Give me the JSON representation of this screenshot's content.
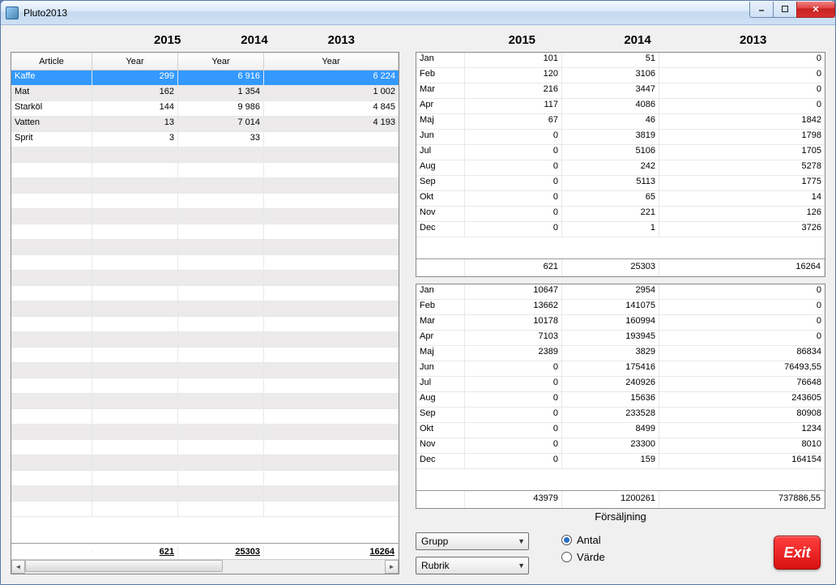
{
  "window": {
    "title": "Pluto2013"
  },
  "years": [
    "2015",
    "2014",
    "2013"
  ],
  "left": {
    "headers": [
      "Article",
      "Year",
      "Year",
      "Year"
    ],
    "rows": [
      {
        "article": "Kaffe",
        "y2015": "299",
        "y2014": "6 916",
        "y2013": "6 224",
        "selected": true
      },
      {
        "article": "Mat",
        "y2015": "162",
        "y2014": "1 354",
        "y2013": "1 002"
      },
      {
        "article": "Starköl",
        "y2015": "144",
        "y2014": "9 986",
        "y2013": "4 845"
      },
      {
        "article": "Vatten",
        "y2015": "13",
        "y2014": "7 014",
        "y2013": "4 193"
      },
      {
        "article": "Sprit",
        "y2015": "3",
        "y2014": "33",
        "y2013": ""
      }
    ],
    "empty_rows": 24,
    "footer": {
      "y2015": "621",
      "y2014": "25303",
      "y2013": "16264"
    }
  },
  "top_right": {
    "rows": [
      {
        "m": "Jan",
        "y2015": "101",
        "y2014": "51",
        "y2013": "0"
      },
      {
        "m": "Feb",
        "y2015": "120",
        "y2014": "3106",
        "y2013": "0"
      },
      {
        "m": "Mar",
        "y2015": "216",
        "y2014": "3447",
        "y2013": "0"
      },
      {
        "m": "Apr",
        "y2015": "117",
        "y2014": "4086",
        "y2013": "0"
      },
      {
        "m": "Maj",
        "y2015": "67",
        "y2014": "46",
        "y2013": "1842"
      },
      {
        "m": "Jun",
        "y2015": "0",
        "y2014": "3819",
        "y2013": "1798"
      },
      {
        "m": "Jul",
        "y2015": "0",
        "y2014": "5106",
        "y2013": "1705"
      },
      {
        "m": "Aug",
        "y2015": "0",
        "y2014": "242",
        "y2013": "5278"
      },
      {
        "m": "Sep",
        "y2015": "0",
        "y2014": "5113",
        "y2013": "1775"
      },
      {
        "m": "Okt",
        "y2015": "0",
        "y2014": "65",
        "y2013": "14"
      },
      {
        "m": "Nov",
        "y2015": "0",
        "y2014": "221",
        "y2013": "126"
      },
      {
        "m": "Dec",
        "y2015": "0",
        "y2014": "1",
        "y2013": "3726"
      }
    ],
    "totals": {
      "y2015": "621",
      "y2014": "25303",
      "y2013": "16264"
    }
  },
  "bottom_right": {
    "rows": [
      {
        "m": "Jan",
        "y2015": "10647",
        "y2014": "2954",
        "y2013": "0"
      },
      {
        "m": "Feb",
        "y2015": "13662",
        "y2014": "141075",
        "y2013": "0"
      },
      {
        "m": "Mar",
        "y2015": "10178",
        "y2014": "160994",
        "y2013": "0"
      },
      {
        "m": "Apr",
        "y2015": "7103",
        "y2014": "193945",
        "y2013": "0"
      },
      {
        "m": "Maj",
        "y2015": "2389",
        "y2014": "3829",
        "y2013": "86834"
      },
      {
        "m": "Jun",
        "y2015": "0",
        "y2014": "175416",
        "y2013": "76493,55"
      },
      {
        "m": "Jul",
        "y2015": "0",
        "y2014": "240926",
        "y2013": "76648"
      },
      {
        "m": "Aug",
        "y2015": "0",
        "y2014": "15636",
        "y2013": "243605"
      },
      {
        "m": "Sep",
        "y2015": "0",
        "y2014": "233528",
        "y2013": "80908"
      },
      {
        "m": "Okt",
        "y2015": "0",
        "y2014": "8499",
        "y2013": "1234"
      },
      {
        "m": "Nov",
        "y2015": "0",
        "y2014": "23300",
        "y2013": "8010"
      },
      {
        "m": "Dec",
        "y2015": "0",
        "y2014": "159",
        "y2013": "164154"
      }
    ],
    "totals": {
      "y2015": "43979",
      "y2014": "1200261",
      "y2013": "737886,55"
    }
  },
  "footer_label": "Försäljning",
  "combos": {
    "grupp": "Grupp",
    "rubrik": "Rubrik"
  },
  "radios": {
    "antal": "Antal",
    "varde": "Värde",
    "selected": "antal"
  },
  "exit": "Exit"
}
